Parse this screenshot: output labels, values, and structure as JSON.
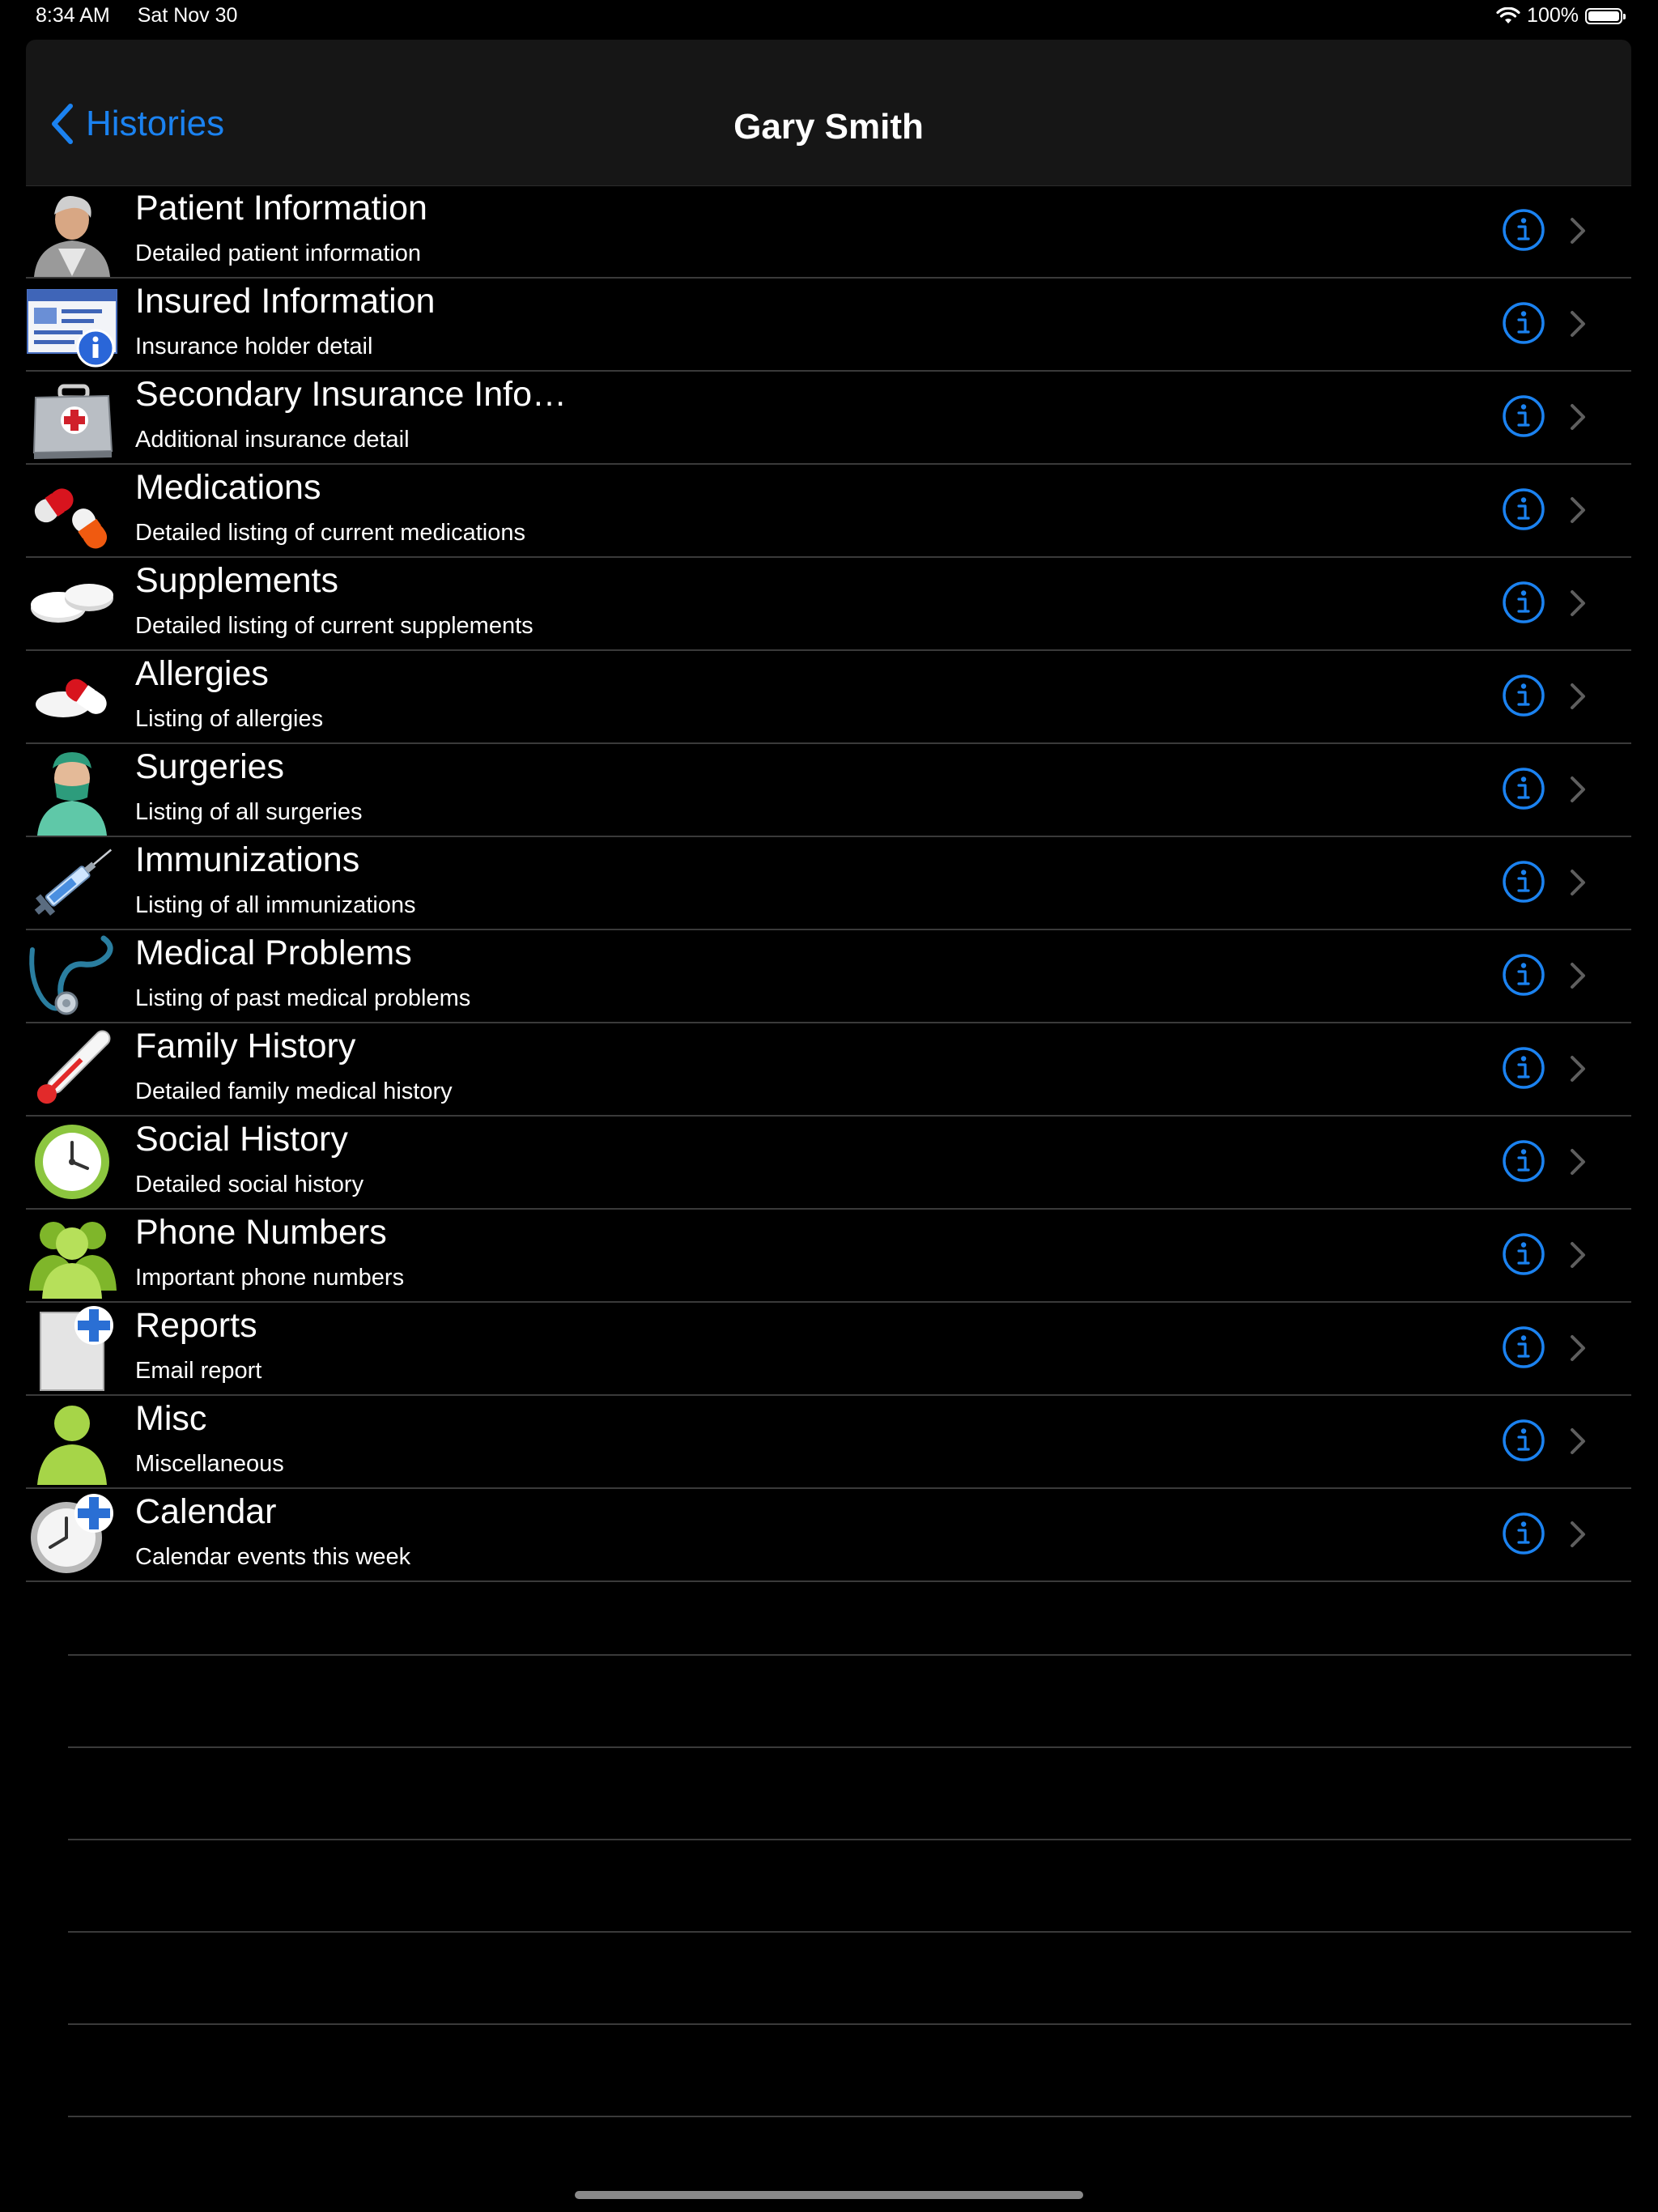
{
  "status_bar": {
    "time": "8:34 AM",
    "date": "Sat Nov 30",
    "battery": "100%",
    "battery_level": 1.0
  },
  "nav": {
    "back_label": "Histories",
    "title": "Gary Smith"
  },
  "colors": {
    "accent": "#1b82f0",
    "background": "#000000",
    "separator": "#3a3a3a",
    "nav_background": "#161616"
  },
  "rows": [
    {
      "title": "Patient Information",
      "subtitle": "Detailed patient information",
      "icon": "patient-icon"
    },
    {
      "title": "Insured Information",
      "subtitle": "Insurance holder detail",
      "icon": "insurance-card-icon"
    },
    {
      "title": "Secondary Insurance Info…",
      "subtitle": "Additional insurance detail",
      "icon": "first-aid-kit-icon"
    },
    {
      "title": "Medications",
      "subtitle": "Detailed listing of current medications",
      "icon": "pill-capsule-icon"
    },
    {
      "title": "Supplements",
      "subtitle": "Detailed listing of current supplements",
      "icon": "supplement-tablet-icon"
    },
    {
      "title": "Allergies",
      "subtitle": "Listing of allergies",
      "icon": "allergy-pill-icon"
    },
    {
      "title": "Surgeries",
      "subtitle": "Listing of all surgeries",
      "icon": "surgeon-icon"
    },
    {
      "title": "Immunizations",
      "subtitle": "Listing of all immunizations",
      "icon": "syringe-icon"
    },
    {
      "title": "Medical Problems",
      "subtitle": "Listing of past medical problems",
      "icon": "stethoscope-icon"
    },
    {
      "title": "Family History",
      "subtitle": "Detailed family medical history",
      "icon": "thermometer-icon"
    },
    {
      "title": "Social History",
      "subtitle": "Detailed social history",
      "icon": "clock-icon"
    },
    {
      "title": "Phone Numbers",
      "subtitle": "Important phone numbers",
      "icon": "contacts-group-icon"
    },
    {
      "title": "Reports",
      "subtitle": "Email report",
      "icon": "new-document-icon"
    },
    {
      "title": "Misc",
      "subtitle": "Miscellaneous",
      "icon": "person-icon"
    },
    {
      "title": "Calendar",
      "subtitle": "Calendar events this week",
      "icon": "clock-add-icon"
    }
  ]
}
